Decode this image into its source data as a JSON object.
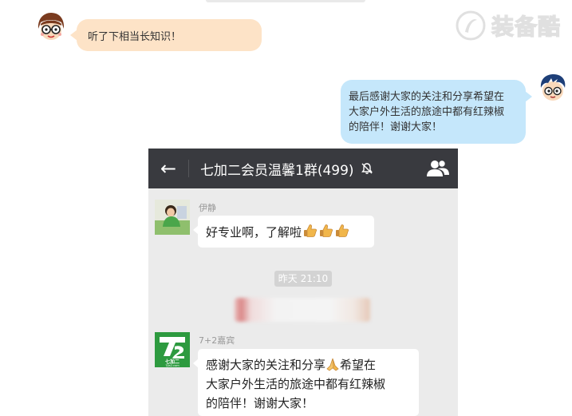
{
  "watermark": {
    "text": "装备酷",
    "icon": "swirl-logo-icon"
  },
  "top_chat": {
    "left_message": "听了下相当长知识！",
    "right_message_lines": [
      "最后感谢大家的关注和分享希望在",
      "大家户外生活的旅途中都有红辣椒",
      "的陪伴！谢谢大家！"
    ]
  },
  "wechat": {
    "title": "七加二会员温馨1群(499)",
    "icons": {
      "back": "back-arrow-icon",
      "mute": "mute-bell-icon",
      "members": "group-members-icon"
    },
    "messages": [
      {
        "sender": "伊静",
        "text": "好专业啊，了解啦",
        "emoji": "thumbs-up-icon",
        "emoji_count": 3
      },
      {
        "sender": "7+2嘉宾",
        "lines": [
          "感谢大家的关注和分享",
          "希望在",
          "大家户外生活的旅途中都有红辣椒",
          "的陪伴！谢谢大家！"
        ],
        "emoji": "folded-hands-icon"
      }
    ],
    "timestamp": "昨天 21:10",
    "logo_text": {
      "main": "7+2",
      "cn": "七加二",
      "url": "7jia2.com"
    }
  },
  "colors": {
    "peach": "#fde3c7",
    "blue": "#c5e7fb",
    "titlebar": "#393a3f",
    "logo_green": "#2d9a3f"
  }
}
